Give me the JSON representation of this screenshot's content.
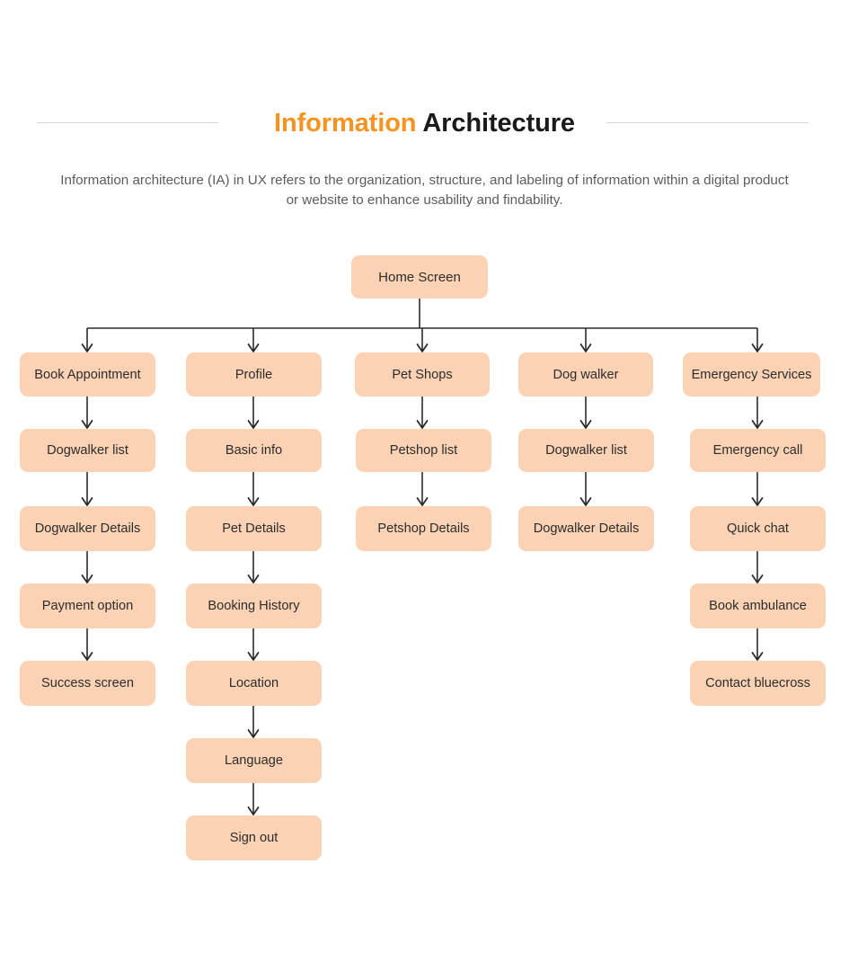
{
  "header": {
    "title_accent": "Information",
    "title_plain": "Architecture",
    "accent_color": "#F7931E",
    "title_color": "#1a1a1a",
    "rule_color": "#d7d7d7"
  },
  "description": "Information architecture (IA) in UX refers to the organization, structure, and labeling of information within a digital product or website to enhance usability and findability.",
  "diagram": {
    "node_fill": "#FBD3B4",
    "node_text_color": "#2c2c2c",
    "connector_color": "#2b2b2b",
    "root": {
      "label": "Home Screen"
    },
    "columns": [
      {
        "name": "book-appointment",
        "nodes": [
          {
            "label": "Book Appointment"
          },
          {
            "label": "Dogwalker list"
          },
          {
            "label": "Dogwalker Details"
          },
          {
            "label": "Payment option"
          },
          {
            "label": "Success screen"
          }
        ]
      },
      {
        "name": "profile",
        "nodes": [
          {
            "label": "Profile"
          },
          {
            "label": "Basic info"
          },
          {
            "label": "Pet Details"
          },
          {
            "label": "Booking History"
          },
          {
            "label": "Location"
          },
          {
            "label": "Language"
          },
          {
            "label": "Sign out"
          }
        ]
      },
      {
        "name": "pet-shops",
        "nodes": [
          {
            "label": "Pet Shops"
          },
          {
            "label": "Petshop list"
          },
          {
            "label": "Petshop Details"
          }
        ]
      },
      {
        "name": "dog-walker",
        "nodes": [
          {
            "label": "Dog walker"
          },
          {
            "label": "Dogwalker list"
          },
          {
            "label": "Dogwalker Details"
          }
        ]
      },
      {
        "name": "emergency-services",
        "nodes": [
          {
            "label": "Emergency Services"
          },
          {
            "label": "Emergency call"
          },
          {
            "label": "Quick chat"
          },
          {
            "label": "Book ambulance"
          },
          {
            "label": "Contact bluecross"
          }
        ]
      }
    ]
  }
}
